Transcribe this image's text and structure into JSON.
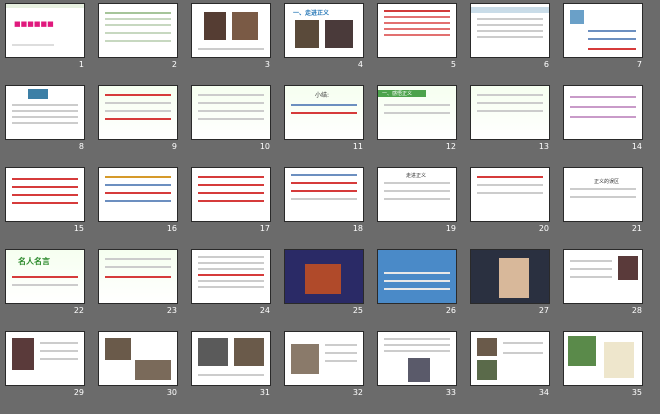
{
  "slides": [
    {
      "num": "1",
      "title": "",
      "style": "title"
    },
    {
      "num": "2",
      "title": "",
      "style": "text"
    },
    {
      "num": "3",
      "title": "",
      "style": "photo"
    },
    {
      "num": "4",
      "title": "一、走进正义",
      "style": "heading"
    },
    {
      "num": "5",
      "title": "",
      "style": "text"
    },
    {
      "num": "6",
      "title": "",
      "style": "text"
    },
    {
      "num": "7",
      "title": "",
      "style": "question"
    },
    {
      "num": "8",
      "title": "",
      "style": "text"
    },
    {
      "num": "9",
      "title": "",
      "style": "text"
    },
    {
      "num": "10",
      "title": "",
      "style": "text"
    },
    {
      "num": "11",
      "title": "小结:",
      "style": "summary"
    },
    {
      "num": "12",
      "title": "一、感悟正义",
      "style": "greenhead"
    },
    {
      "num": "13",
      "title": "",
      "style": "text"
    },
    {
      "num": "14",
      "title": "",
      "style": "text"
    },
    {
      "num": "15",
      "title": "",
      "style": "redtext"
    },
    {
      "num": "16",
      "title": "",
      "style": "text"
    },
    {
      "num": "17",
      "title": "",
      "style": "redtext"
    },
    {
      "num": "18",
      "title": "",
      "style": "text"
    },
    {
      "num": "19",
      "title": "走进正义",
      "style": "text"
    },
    {
      "num": "20",
      "title": "",
      "style": "text"
    },
    {
      "num": "21",
      "title": "正义的误区",
      "style": "text"
    },
    {
      "num": "22",
      "title": "名人名言",
      "style": "quote"
    },
    {
      "num": "23",
      "title": "",
      "style": "text"
    },
    {
      "num": "24",
      "title": "",
      "style": "text"
    },
    {
      "num": "25",
      "title": "",
      "style": "photo"
    },
    {
      "num": "26",
      "title": "",
      "style": "photo"
    },
    {
      "num": "27",
      "title": "",
      "style": "photo"
    },
    {
      "num": "28",
      "title": "",
      "style": "photo"
    },
    {
      "num": "29",
      "title": "",
      "style": "photo"
    },
    {
      "num": "30",
      "title": "",
      "style": "photo"
    },
    {
      "num": "31",
      "title": "",
      "style": "photo"
    },
    {
      "num": "32",
      "title": "",
      "style": "photo"
    },
    {
      "num": "33",
      "title": "",
      "style": "photo"
    },
    {
      "num": "34",
      "title": "",
      "style": "photo"
    },
    {
      "num": "35",
      "title": "",
      "style": "photo"
    }
  ]
}
